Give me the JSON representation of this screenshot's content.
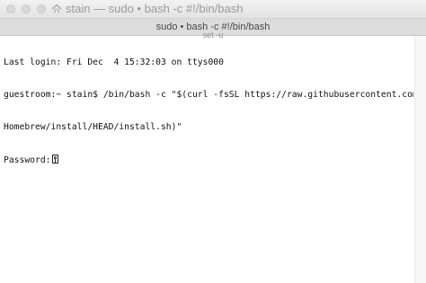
{
  "window": {
    "title": "stain — sudo • bash -c #!/bin/bash",
    "traffic_lights": [
      "close-button",
      "minimize-button",
      "zoom-button"
    ],
    "title_icon": "home-icon"
  },
  "tab": {
    "label": "sudo • bash -c #!/bin/bash",
    "sublabel": "set -u"
  },
  "terminal": {
    "lines": [
      "Last login: Fri Dec  4 15:32:03 on ttys000",
      "guestroom:~ stain$ /bin/bash -c \"$(curl -fsSL https://raw.githubusercontent.com/",
      "Homebrew/install/HEAD/install.sh)\"",
      "Password:"
    ],
    "cursor_icon": "key-icon"
  }
}
